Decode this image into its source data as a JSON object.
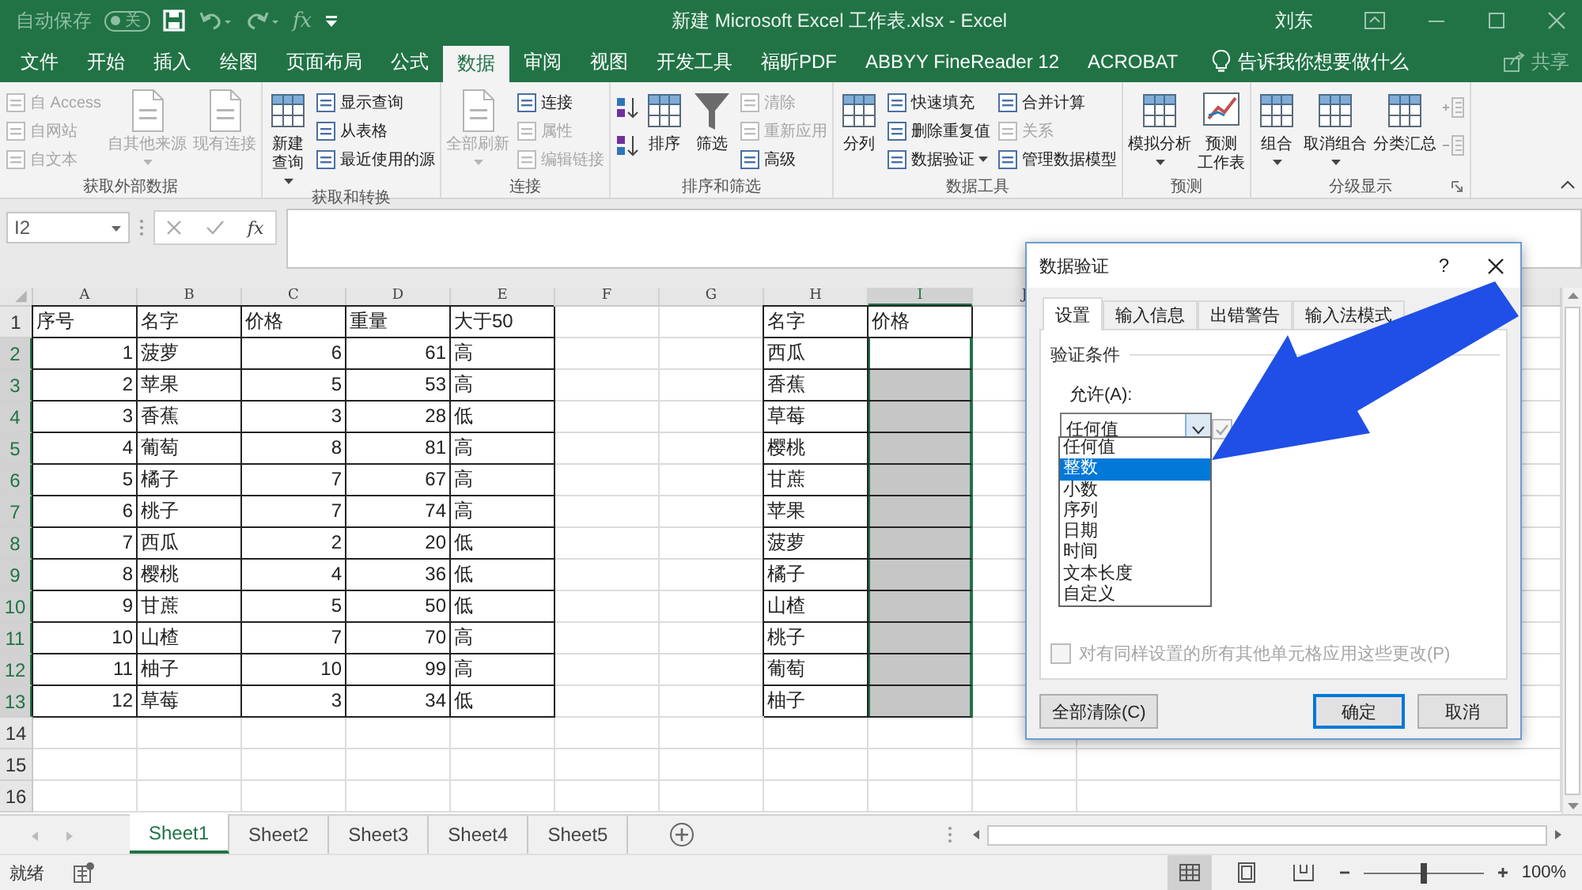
{
  "title_bar": {
    "autosave_label": "自动保存",
    "autosave_state": "关",
    "autosave_on": false,
    "formula_shortcut": "fx",
    "title": "新建 Microsoft Excel 工作表.xlsx - Excel",
    "user": "刘东"
  },
  "tabs": [
    {
      "label": "文件",
      "selected": false
    },
    {
      "label": "开始",
      "selected": false
    },
    {
      "label": "插入",
      "selected": false
    },
    {
      "label": "绘图",
      "selected": false
    },
    {
      "label": "页面布局",
      "selected": false
    },
    {
      "label": "公式",
      "selected": false
    },
    {
      "label": "数据",
      "selected": true
    },
    {
      "label": "审阅",
      "selected": false
    },
    {
      "label": "视图",
      "selected": false
    },
    {
      "label": "开发工具",
      "selected": false
    },
    {
      "label": "福昕PDF",
      "selected": false
    },
    {
      "label": "ABBYY FineReader 12",
      "selected": false
    },
    {
      "label": "ACROBAT",
      "selected": false
    }
  ],
  "tell_me": "告诉我你想要做什么",
  "share": "共享",
  "ribbon_groups": [
    {
      "label": "获取外部数据",
      "columns": [
        {
          "kind": "stack",
          "items": [
            {
              "label": "自 Access",
              "disabled": true,
              "dropdown": false
            },
            {
              "label": "自网站",
              "disabled": true,
              "dropdown": false
            },
            {
              "label": "自文本",
              "disabled": true,
              "dropdown": false
            }
          ]
        },
        {
          "kind": "large",
          "lines": [
            "自其他来源"
          ],
          "disabled": true,
          "dropdown": true
        },
        {
          "kind": "large",
          "lines": [
            "现有连接"
          ],
          "disabled": true,
          "dropdown": false
        }
      ]
    },
    {
      "label": "获取和转换",
      "columns": [
        {
          "kind": "large",
          "lines": [
            "新建",
            "查询"
          ],
          "disabled": false,
          "dropdown": true
        },
        {
          "kind": "stack",
          "items": [
            {
              "label": "显示查询",
              "disabled": false,
              "dropdown": false
            },
            {
              "label": "从表格",
              "disabled": false,
              "dropdown": false
            },
            {
              "label": "最近使用的源",
              "disabled": false,
              "dropdown": false
            }
          ]
        }
      ]
    },
    {
      "label": "连接",
      "columns": [
        {
          "kind": "large",
          "lines": [
            "全部刷新"
          ],
          "disabled": true,
          "dropdown": true
        },
        {
          "kind": "stack",
          "items": [
            {
              "label": "连接",
              "disabled": false,
              "dropdown": false
            },
            {
              "label": "属性",
              "disabled": true,
              "dropdown": false
            },
            {
              "label": "编辑链接",
              "disabled": true,
              "dropdown": false
            }
          ]
        }
      ]
    },
    {
      "label": "排序和筛选",
      "columns": [
        {
          "kind": "sort"
        },
        {
          "kind": "large",
          "lines": [
            "排序"
          ],
          "disabled": false,
          "dropdown": false
        },
        {
          "kind": "large",
          "lines": [
            "筛选"
          ],
          "disabled": false,
          "dropdown": false
        },
        {
          "kind": "stack",
          "items": [
            {
              "label": "清除",
              "disabled": true,
              "dropdown": false
            },
            {
              "label": "重新应用",
              "disabled": true,
              "dropdown": false
            },
            {
              "label": "高级",
              "disabled": false,
              "dropdown": false
            }
          ]
        }
      ]
    },
    {
      "label": "数据工具",
      "columns": [
        {
          "kind": "large",
          "lines": [
            "分列"
          ],
          "disabled": false,
          "dropdown": false
        },
        {
          "kind": "stack",
          "items": [
            {
              "label": "快速填充",
              "disabled": false,
              "dropdown": false
            },
            {
              "label": "删除重复值",
              "disabled": false,
              "dropdown": false
            },
            {
              "label": "数据验证",
              "disabled": false,
              "dropdown": true
            }
          ]
        },
        {
          "kind": "stack",
          "items": [
            {
              "label": "合并计算",
              "disabled": false,
              "dropdown": false
            },
            {
              "label": "关系",
              "disabled": true,
              "dropdown": false
            },
            {
              "label": "管理数据模型",
              "disabled": false,
              "dropdown": false
            }
          ]
        }
      ]
    },
    {
      "label": "预测",
      "columns": [
        {
          "kind": "large",
          "lines": [
            "模拟分析"
          ],
          "disabled": false,
          "dropdown": true
        },
        {
          "kind": "large",
          "lines": [
            "预测",
            "工作表"
          ],
          "disabled": false,
          "dropdown": false
        }
      ]
    },
    {
      "label": "分级显示",
      "launcher": true,
      "columns": [
        {
          "kind": "large",
          "lines": [
            "组合"
          ],
          "disabled": false,
          "dropdown": true
        },
        {
          "kind": "large",
          "lines": [
            "取消组合"
          ],
          "disabled": false,
          "dropdown": true
        },
        {
          "kind": "large",
          "lines": [
            "分类汇总"
          ],
          "disabled": false,
          "dropdown": false
        },
        {
          "kind": "outline"
        }
      ]
    }
  ],
  "formula_bar": {
    "name_box": "I2",
    "function_button": "fx"
  },
  "sheet": {
    "columns": [
      {
        "label": "A",
        "selected": false
      },
      {
        "label": "B",
        "selected": false
      },
      {
        "label": "C",
        "selected": false
      },
      {
        "label": "D",
        "selected": false
      },
      {
        "label": "E",
        "selected": false
      },
      {
        "label": "F",
        "selected": false
      },
      {
        "label": "G",
        "selected": false
      },
      {
        "label": "H",
        "selected": false
      },
      {
        "label": "I",
        "selected": true
      },
      {
        "label": "J",
        "selected": false
      }
    ],
    "rows": [
      {
        "label": "1",
        "selected": false,
        "cells": [
          {
            "kind": "text",
            "bordered": true,
            "selected": false,
            "text": "序号"
          },
          {
            "kind": "text",
            "bordered": true,
            "selected": false,
            "text": "名字"
          },
          {
            "kind": "text",
            "bordered": true,
            "selected": false,
            "text": "价格"
          },
          {
            "kind": "text",
            "bordered": true,
            "selected": false,
            "text": "重量"
          },
          {
            "kind": "text",
            "bordered": true,
            "selected": false,
            "text": "大于50"
          },
          {
            "kind": "empty",
            "bordered": false,
            "selected": false
          },
          {
            "kind": "empty",
            "bordered": false,
            "selected": false
          },
          {
            "kind": "text",
            "bordered": true,
            "selected": false,
            "text": "名字"
          },
          {
            "kind": "text",
            "bordered": true,
            "selected": false,
            "text": "价格"
          },
          {
            "kind": "empty",
            "bordered": false,
            "selected": false
          }
        ]
      },
      {
        "label": "2",
        "selected": true,
        "cells": [
          {
            "kind": "number",
            "bordered": true,
            "selected": false,
            "text": "1"
          },
          {
            "kind": "text",
            "bordered": true,
            "selected": false,
            "text": "菠萝"
          },
          {
            "kind": "number",
            "bordered": true,
            "selected": false,
            "text": "6"
          },
          {
            "kind": "number",
            "bordered": true,
            "selected": false,
            "text": "61"
          },
          {
            "kind": "text",
            "bordered": true,
            "selected": false,
            "text": "高"
          },
          {
            "kind": "empty",
            "bordered": false,
            "selected": false
          },
          {
            "kind": "empty",
            "bordered": false,
            "selected": false
          },
          {
            "kind": "text",
            "bordered": true,
            "selected": false,
            "text": "西瓜"
          },
          {
            "kind": "empty",
            "bordered": true,
            "selected": false
          },
          {
            "kind": "empty",
            "bordered": false,
            "selected": false
          }
        ]
      },
      {
        "label": "3",
        "selected": true,
        "cells": [
          {
            "kind": "number",
            "bordered": true,
            "selected": false,
            "text": "2"
          },
          {
            "kind": "text",
            "bordered": true,
            "selected": false,
            "text": "苹果"
          },
          {
            "kind": "number",
            "bordered": true,
            "selected": false,
            "text": "5"
          },
          {
            "kind": "number",
            "bordered": true,
            "selected": false,
            "text": "53"
          },
          {
            "kind": "text",
            "bordered": true,
            "selected": false,
            "text": "高"
          },
          {
            "kind": "empty",
            "bordered": false,
            "selected": false
          },
          {
            "kind": "empty",
            "bordered": false,
            "selected": false
          },
          {
            "kind": "text",
            "bordered": true,
            "selected": false,
            "text": "香蕉"
          },
          {
            "kind": "empty",
            "bordered": true,
            "selected": true
          },
          {
            "kind": "empty",
            "bordered": false,
            "selected": false
          }
        ]
      },
      {
        "label": "4",
        "selected": true,
        "cells": [
          {
            "kind": "number",
            "bordered": true,
            "selected": false,
            "text": "3"
          },
          {
            "kind": "text",
            "bordered": true,
            "selected": false,
            "text": "香蕉"
          },
          {
            "kind": "number",
            "bordered": true,
            "selected": false,
            "text": "3"
          },
          {
            "kind": "number",
            "bordered": true,
            "selected": false,
            "text": "28"
          },
          {
            "kind": "text",
            "bordered": true,
            "selected": false,
            "text": "低"
          },
          {
            "kind": "empty",
            "bordered": false,
            "selected": false
          },
          {
            "kind": "empty",
            "bordered": false,
            "selected": false
          },
          {
            "kind": "text",
            "bordered": true,
            "selected": false,
            "text": "草莓"
          },
          {
            "kind": "empty",
            "bordered": true,
            "selected": true
          },
          {
            "kind": "empty",
            "bordered": false,
            "selected": false
          }
        ]
      },
      {
        "label": "5",
        "selected": true,
        "cells": [
          {
            "kind": "number",
            "bordered": true,
            "selected": false,
            "text": "4"
          },
          {
            "kind": "text",
            "bordered": true,
            "selected": false,
            "text": "葡萄"
          },
          {
            "kind": "number",
            "bordered": true,
            "selected": false,
            "text": "8"
          },
          {
            "kind": "number",
            "bordered": true,
            "selected": false,
            "text": "81"
          },
          {
            "kind": "text",
            "bordered": true,
            "selected": false,
            "text": "高"
          },
          {
            "kind": "empty",
            "bordered": false,
            "selected": false
          },
          {
            "kind": "empty",
            "bordered": false,
            "selected": false
          },
          {
            "kind": "text",
            "bordered": true,
            "selected": false,
            "text": "樱桃"
          },
          {
            "kind": "empty",
            "bordered": true,
            "selected": true
          },
          {
            "kind": "empty",
            "bordered": false,
            "selected": false
          }
        ]
      },
      {
        "label": "6",
        "selected": true,
        "cells": [
          {
            "kind": "number",
            "bordered": true,
            "selected": false,
            "text": "5"
          },
          {
            "kind": "text",
            "bordered": true,
            "selected": false,
            "text": "橘子"
          },
          {
            "kind": "number",
            "bordered": true,
            "selected": false,
            "text": "7"
          },
          {
            "kind": "number",
            "bordered": true,
            "selected": false,
            "text": "67"
          },
          {
            "kind": "text",
            "bordered": true,
            "selected": false,
            "text": "高"
          },
          {
            "kind": "empty",
            "bordered": false,
            "selected": false
          },
          {
            "kind": "empty",
            "bordered": false,
            "selected": false
          },
          {
            "kind": "text",
            "bordered": true,
            "selected": false,
            "text": "甘蔗"
          },
          {
            "kind": "empty",
            "bordered": true,
            "selected": true
          },
          {
            "kind": "empty",
            "bordered": false,
            "selected": false
          }
        ]
      },
      {
        "label": "7",
        "selected": true,
        "cells": [
          {
            "kind": "number",
            "bordered": true,
            "selected": false,
            "text": "6"
          },
          {
            "kind": "text",
            "bordered": true,
            "selected": false,
            "text": "桃子"
          },
          {
            "kind": "number",
            "bordered": true,
            "selected": false,
            "text": "7"
          },
          {
            "kind": "number",
            "bordered": true,
            "selected": false,
            "text": "74"
          },
          {
            "kind": "text",
            "bordered": true,
            "selected": false,
            "text": "高"
          },
          {
            "kind": "empty",
            "bordered": false,
            "selected": false
          },
          {
            "kind": "empty",
            "bordered": false,
            "selected": false
          },
          {
            "kind": "text",
            "bordered": true,
            "selected": false,
            "text": "苹果"
          },
          {
            "kind": "empty",
            "bordered": true,
            "selected": true
          },
          {
            "kind": "empty",
            "bordered": false,
            "selected": false
          }
        ]
      },
      {
        "label": "8",
        "selected": true,
        "cells": [
          {
            "kind": "number",
            "bordered": true,
            "selected": false,
            "text": "7"
          },
          {
            "kind": "text",
            "bordered": true,
            "selected": false,
            "text": "西瓜"
          },
          {
            "kind": "number",
            "bordered": true,
            "selected": false,
            "text": "2"
          },
          {
            "kind": "number",
            "bordered": true,
            "selected": false,
            "text": "20"
          },
          {
            "kind": "text",
            "bordered": true,
            "selected": false,
            "text": "低"
          },
          {
            "kind": "empty",
            "bordered": false,
            "selected": false
          },
          {
            "kind": "empty",
            "bordered": false,
            "selected": false
          },
          {
            "kind": "text",
            "bordered": true,
            "selected": false,
            "text": "菠萝"
          },
          {
            "kind": "empty",
            "bordered": true,
            "selected": true
          },
          {
            "kind": "empty",
            "bordered": false,
            "selected": false
          }
        ]
      },
      {
        "label": "9",
        "selected": true,
        "cells": [
          {
            "kind": "number",
            "bordered": true,
            "selected": false,
            "text": "8"
          },
          {
            "kind": "text",
            "bordered": true,
            "selected": false,
            "text": "樱桃"
          },
          {
            "kind": "number",
            "bordered": true,
            "selected": false,
            "text": "4"
          },
          {
            "kind": "number",
            "bordered": true,
            "selected": false,
            "text": "36"
          },
          {
            "kind": "text",
            "bordered": true,
            "selected": false,
            "text": "低"
          },
          {
            "kind": "empty",
            "bordered": false,
            "selected": false
          },
          {
            "kind": "empty",
            "bordered": false,
            "selected": false
          },
          {
            "kind": "text",
            "bordered": true,
            "selected": false,
            "text": "橘子"
          },
          {
            "kind": "empty",
            "bordered": true,
            "selected": true
          },
          {
            "kind": "empty",
            "bordered": false,
            "selected": false
          }
        ]
      },
      {
        "label": "10",
        "selected": true,
        "cells": [
          {
            "kind": "number",
            "bordered": true,
            "selected": false,
            "text": "9"
          },
          {
            "kind": "text",
            "bordered": true,
            "selected": false,
            "text": "甘蔗"
          },
          {
            "kind": "number",
            "bordered": true,
            "selected": false,
            "text": "5"
          },
          {
            "kind": "number",
            "bordered": true,
            "selected": false,
            "text": "50"
          },
          {
            "kind": "text",
            "bordered": true,
            "selected": false,
            "text": "低"
          },
          {
            "kind": "empty",
            "bordered": false,
            "selected": false
          },
          {
            "kind": "empty",
            "bordered": false,
            "selected": false
          },
          {
            "kind": "text",
            "bordered": true,
            "selected": false,
            "text": "山楂"
          },
          {
            "kind": "empty",
            "bordered": true,
            "selected": true
          },
          {
            "kind": "empty",
            "bordered": false,
            "selected": false
          }
        ]
      },
      {
        "label": "11",
        "selected": true,
        "cells": [
          {
            "kind": "number",
            "bordered": true,
            "selected": false,
            "text": "10"
          },
          {
            "kind": "text",
            "bordered": true,
            "selected": false,
            "text": "山楂"
          },
          {
            "kind": "number",
            "bordered": true,
            "selected": false,
            "text": "7"
          },
          {
            "kind": "number",
            "bordered": true,
            "selected": false,
            "text": "70"
          },
          {
            "kind": "text",
            "bordered": true,
            "selected": false,
            "text": "高"
          },
          {
            "kind": "empty",
            "bordered": false,
            "selected": false
          },
          {
            "kind": "empty",
            "bordered": false,
            "selected": false
          },
          {
            "kind": "text",
            "bordered": true,
            "selected": false,
            "text": "桃子"
          },
          {
            "kind": "empty",
            "bordered": true,
            "selected": true
          },
          {
            "kind": "empty",
            "bordered": false,
            "selected": false
          }
        ]
      },
      {
        "label": "12",
        "selected": true,
        "cells": [
          {
            "kind": "number",
            "bordered": true,
            "selected": false,
            "text": "11"
          },
          {
            "kind": "text",
            "bordered": true,
            "selected": false,
            "text": "柚子"
          },
          {
            "kind": "number",
            "bordered": true,
            "selected": false,
            "text": "10"
          },
          {
            "kind": "number",
            "bordered": true,
            "selected": false,
            "text": "99"
          },
          {
            "kind": "text",
            "bordered": true,
            "selected": false,
            "text": "高"
          },
          {
            "kind": "empty",
            "bordered": false,
            "selected": false
          },
          {
            "kind": "empty",
            "bordered": false,
            "selected": false
          },
          {
            "kind": "text",
            "bordered": true,
            "selected": false,
            "text": "葡萄"
          },
          {
            "kind": "empty",
            "bordered": true,
            "selected": true
          },
          {
            "kind": "empty",
            "bordered": false,
            "selected": false
          }
        ]
      },
      {
        "label": "13",
        "selected": true,
        "cells": [
          {
            "kind": "number",
            "bordered": true,
            "selected": false,
            "text": "12"
          },
          {
            "kind": "text",
            "bordered": true,
            "selected": false,
            "text": "草莓"
          },
          {
            "kind": "number",
            "bordered": true,
            "selected": false,
            "text": "3"
          },
          {
            "kind": "number",
            "bordered": true,
            "selected": false,
            "text": "34"
          },
          {
            "kind": "text",
            "bordered": true,
            "selected": false,
            "text": "低"
          },
          {
            "kind": "empty",
            "bordered": false,
            "selected": false
          },
          {
            "kind": "empty",
            "bordered": false,
            "selected": false
          },
          {
            "kind": "text",
            "bordered": true,
            "selected": false,
            "text": "柚子"
          },
          {
            "kind": "empty",
            "bordered": true,
            "selected": true
          },
          {
            "kind": "empty",
            "bordered": false,
            "selected": false
          }
        ]
      },
      {
        "label": "14",
        "selected": false
      },
      {
        "label": "15",
        "selected": false
      },
      {
        "label": "16",
        "selected": false
      }
    ]
  },
  "sheet_tabs": [
    {
      "label": "Sheet1",
      "selected": true
    },
    {
      "label": "Sheet2",
      "selected": false
    },
    {
      "label": "Sheet3",
      "selected": false
    },
    {
      "label": "Sheet4",
      "selected": false
    },
    {
      "label": "Sheet5",
      "selected": false
    }
  ],
  "status_bar": {
    "status": "就绪",
    "views": [
      {
        "kind": "normal",
        "selected": true
      },
      {
        "kind": "page_layout",
        "selected": false
      },
      {
        "kind": "page_break",
        "selected": false
      }
    ],
    "zoom": {
      "level": 0.5,
      "reading": "100%"
    }
  },
  "dialog": {
    "title": "数据验证",
    "help": "?",
    "tabs": [
      {
        "label": "设置",
        "selected": true
      },
      {
        "label": "输入信息",
        "selected": false
      },
      {
        "label": "出错警告",
        "selected": false
      },
      {
        "label": "输入法模式",
        "selected": false
      }
    ],
    "section": "验证条件",
    "allow_label": "允许(A):",
    "allow_value": "任何值",
    "options": [
      {
        "label": "任何值",
        "selected": false
      },
      {
        "label": "整数",
        "selected": true
      },
      {
        "label": "小数",
        "selected": false
      },
      {
        "label": "序列",
        "selected": false
      },
      {
        "label": "日期",
        "selected": false
      },
      {
        "label": "时间",
        "selected": false
      },
      {
        "label": "文本长度",
        "selected": false
      },
      {
        "label": "自定义",
        "selected": false
      }
    ],
    "ignore_blank": {
      "checked": true,
      "disabled": true
    },
    "apply_all": {
      "label": "对有同样设置的所有其他单元格应用这些更改(P)",
      "checked": false,
      "disabled": true
    },
    "buttons": [
      {
        "label": "全部清除(C)",
        "kind": "normal"
      },
      {
        "label": "确定",
        "kind": "default"
      },
      {
        "label": "取消",
        "kind": "normal"
      }
    ]
  }
}
